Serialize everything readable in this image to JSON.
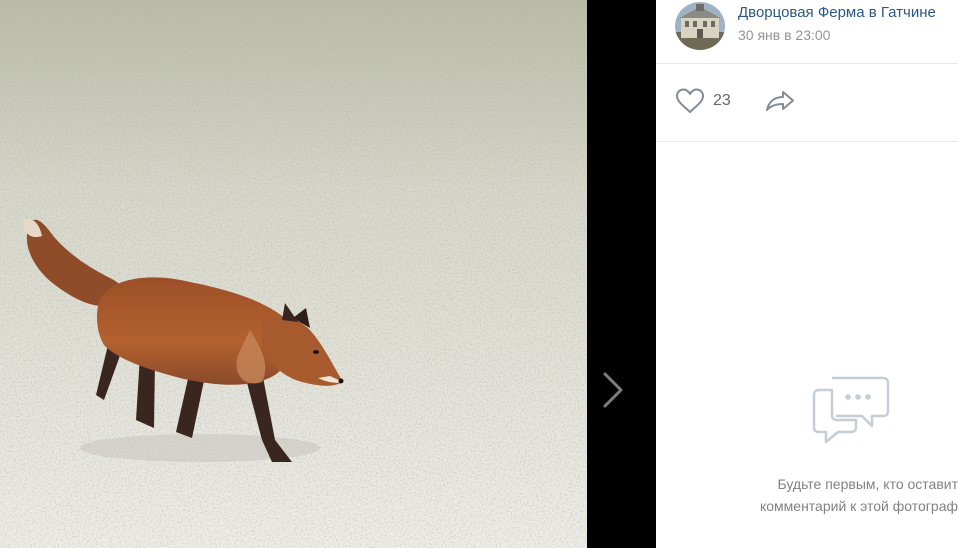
{
  "photo": {
    "subject": "fox-in-snow",
    "colors": {
      "snow": "#e8e6e2",
      "grass": "#8c9470",
      "fox": "#a9552c"
    }
  },
  "viewer": {
    "next_icon": "chevron-right-icon",
    "gutter_color": "#000000"
  },
  "post": {
    "author": "Дворцовая Ферма в Гатчине",
    "date": "30 янв в 23:00",
    "avatar_icon": "building-photo-avatar"
  },
  "actions": {
    "like_icon": "heart-icon",
    "like_count": "23",
    "share_icon": "share-arrow-icon"
  },
  "comments": {
    "empty_icon": "comment-bubble-icon",
    "empty_line1": "Будьте первым, кто оставит",
    "empty_line2": "комментарий к этой фотограф"
  },
  "colors": {
    "link": "#2a5885",
    "muted": "#939393",
    "divider": "#e7e8ec",
    "icon": "#828a99"
  }
}
